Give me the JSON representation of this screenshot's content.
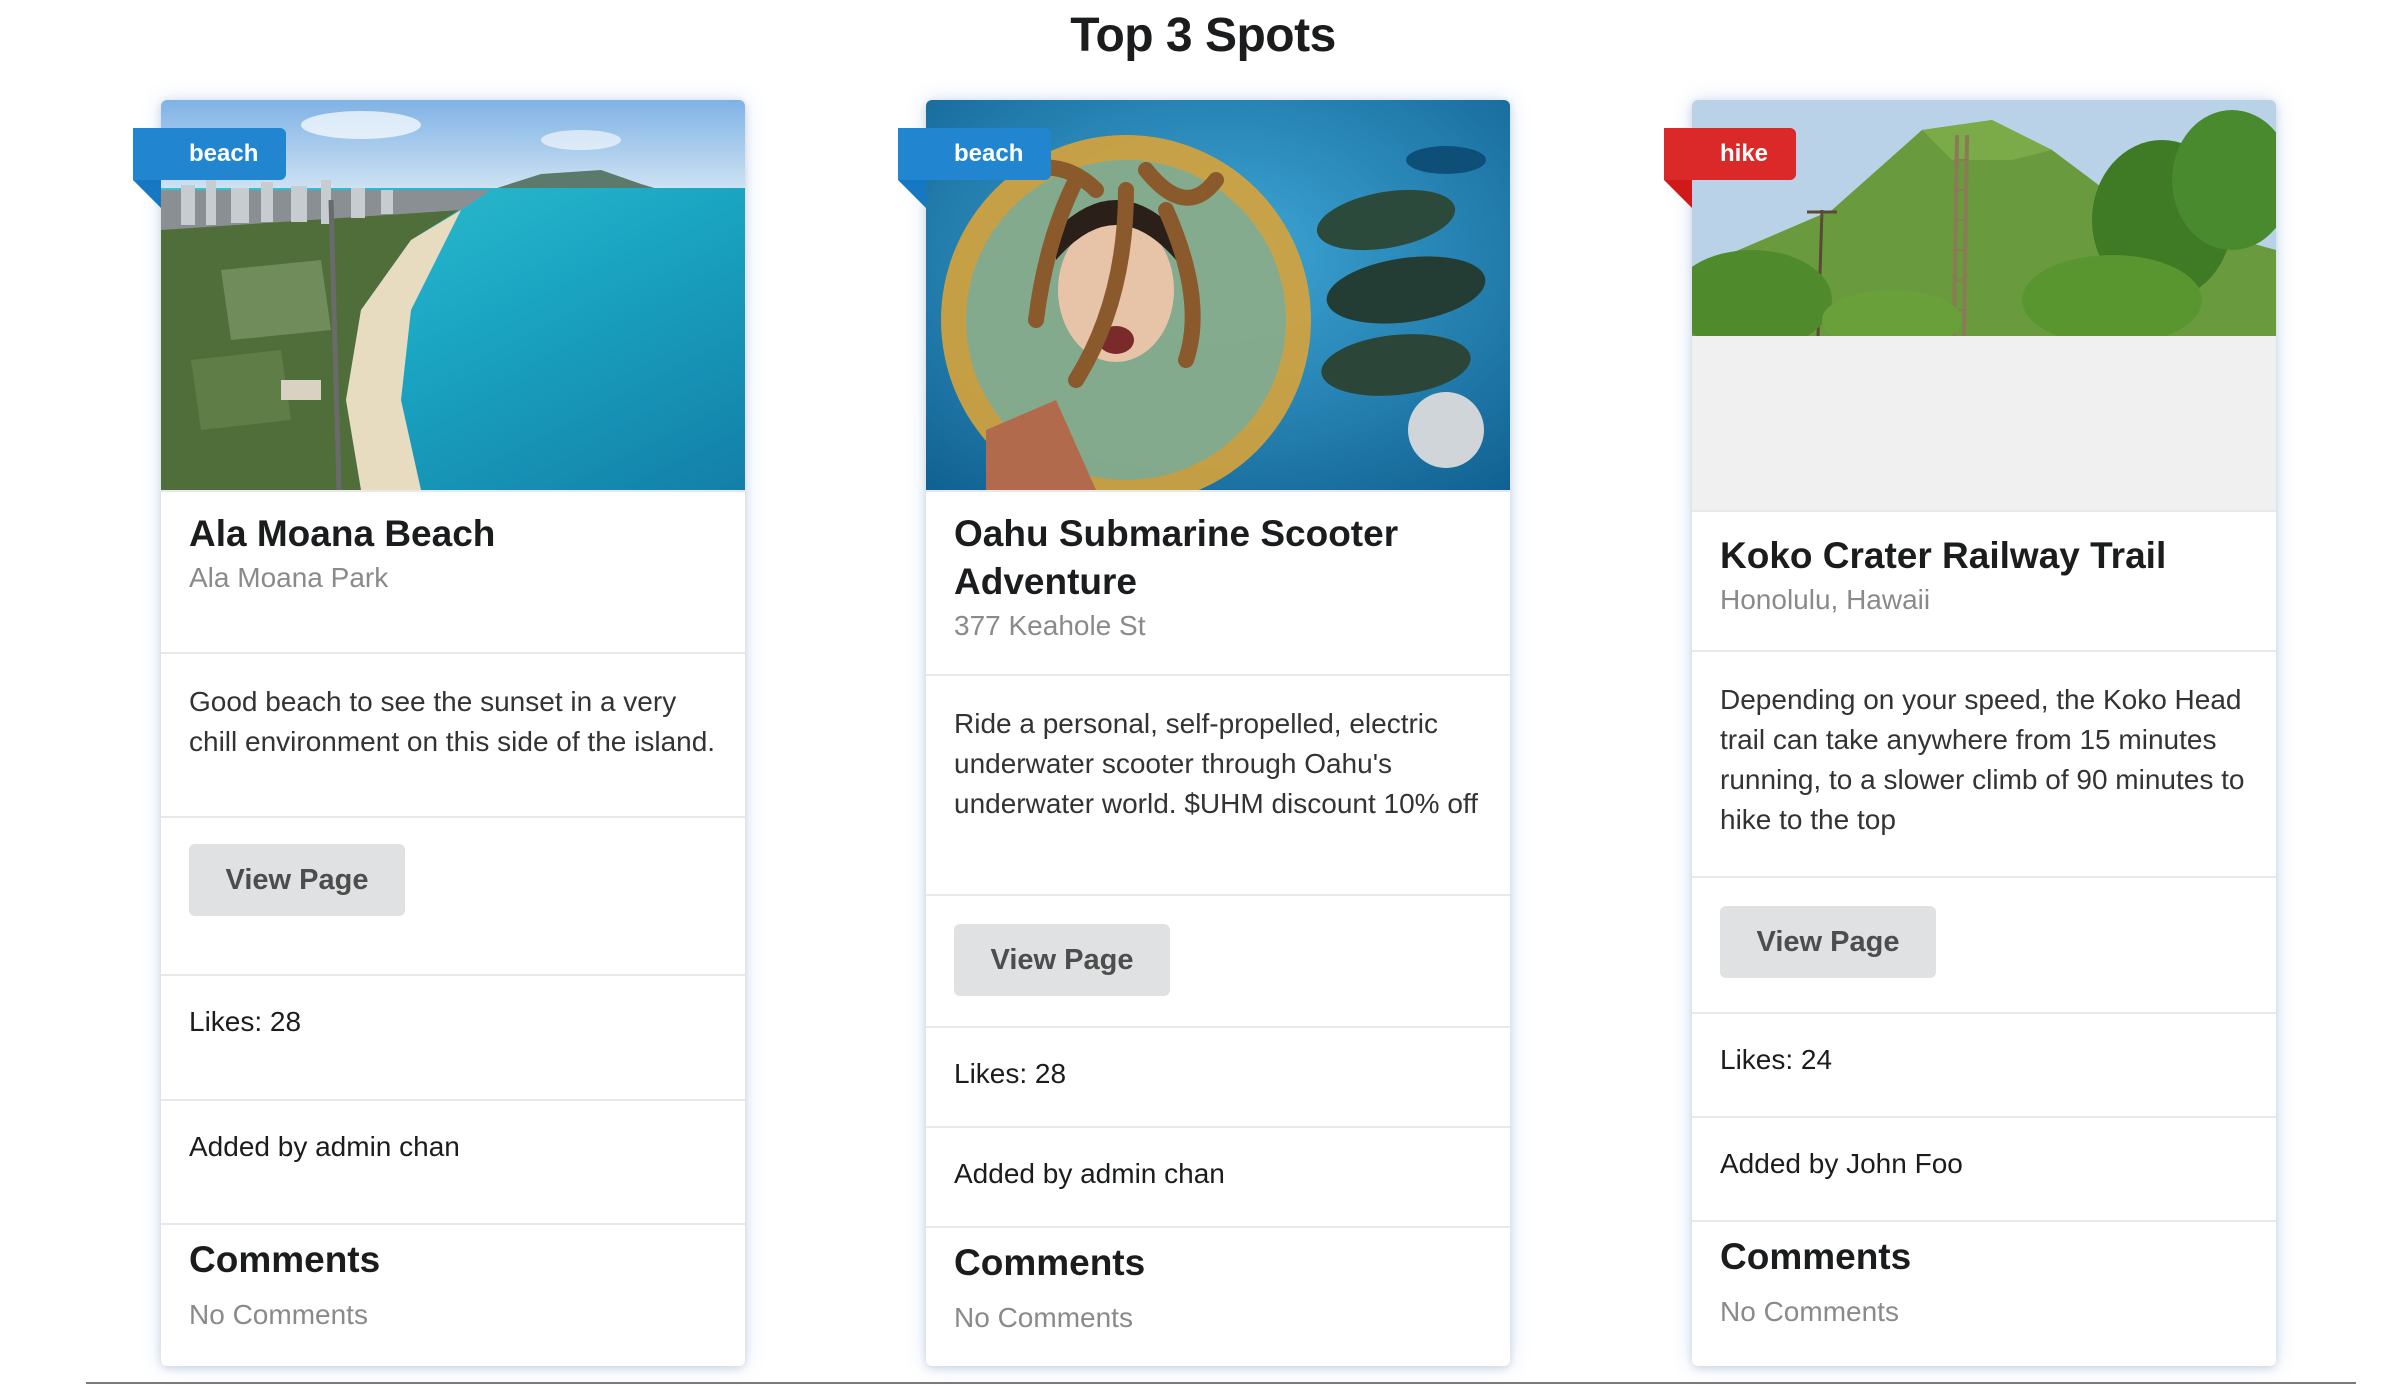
{
  "page": {
    "title": "Top 3 Spots"
  },
  "colors": {
    "beach_ribbon": "#2185d0",
    "hike_ribbon": "#db2828",
    "button_bg": "#e0e1e2"
  },
  "cards": [
    {
      "tag": "beach",
      "image": "aerial beach and city skyline",
      "title": "Ala Moana Beach",
      "meta": "Ala Moana Park",
      "description": "Good beach to see the sunset in a very chill environment on this side of the island.",
      "button": "View Page",
      "likes": "Likes: 28",
      "added_by": "Added by admin chan",
      "comments_heading": "Comments",
      "comments_empty": "No Comments"
    },
    {
      "tag": "beach",
      "image": "underwater diver with octopus and fish",
      "title": "Oahu Submarine Scooter Adventure",
      "meta": "377 Keahole St",
      "description": "Ride a personal, self-propelled, electric underwater scooter through Oahu's underwater world. $UHM discount 10% off",
      "button": "View Page",
      "likes": "Likes: 28",
      "added_by": "Added by admin chan",
      "comments_heading": "Comments",
      "comments_empty": "No Comments"
    },
    {
      "tag": "hike",
      "image": "green crater with railway trail",
      "title": "Koko Crater Railway Trail",
      "meta": "Honolulu, Hawaii",
      "description": "Depending on your speed, the Koko Head trail can take anywhere from 15 minutes running, to a slower climb of 90 minutes to hike to the top",
      "button": "View Page",
      "likes": "Likes: 24",
      "added_by": "Added by John Foo",
      "comments_heading": "Comments",
      "comments_empty": "No Comments"
    }
  ]
}
